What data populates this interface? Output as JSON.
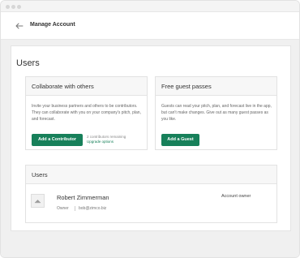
{
  "app": {
    "title": "Manage Account"
  },
  "page": {
    "title": "Users"
  },
  "collaborate": {
    "title": "Collaborate with others",
    "description": "Invite your business partners and others to be contributors. They can collaborate with you on your company's pitch, plan, and forecast.",
    "button": "Add a Contributor",
    "remaining": "2 contributors remaining",
    "upgrade": "Upgrade options"
  },
  "guests": {
    "title": "Free guest passes",
    "description": "Guests can read your pitch, plan, and forecast live in the app, but can't make changes. Give out as many guest passes as you like.",
    "button": "Add a Guest"
  },
  "users_section": {
    "title": "Users",
    "items": [
      {
        "name": "Robert Zimmerman",
        "role": "Owner",
        "email": "bob@zimco.biz",
        "status": "Account owner"
      }
    ]
  },
  "colors": {
    "accent": "#17805a",
    "background": "#f0f0f0"
  },
  "icons": {
    "back": "back-arrow-icon",
    "avatar": "user-placeholder-icon"
  }
}
